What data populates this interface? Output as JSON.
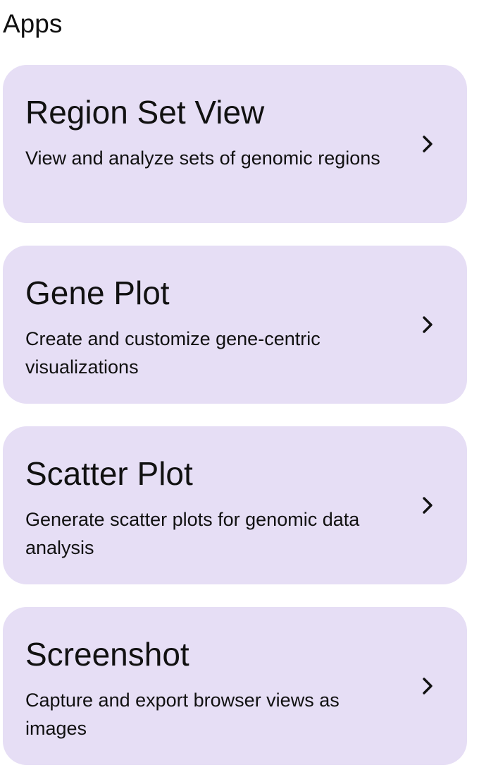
{
  "header": {
    "title": "Apps"
  },
  "apps": [
    {
      "title": "Region Set View",
      "description": "View and analyze sets of genomic regions",
      "icon": "chevron-right-icon"
    },
    {
      "title": "Gene Plot",
      "description": "Create and customize gene-centric visualizations",
      "icon": "chevron-right-icon"
    },
    {
      "title": "Scatter Plot",
      "description": "Generate scatter plots for genomic data analysis",
      "icon": "chevron-right-icon"
    },
    {
      "title": "Screenshot",
      "description": "Capture and export browser views as images",
      "icon": "chevron-right-icon"
    }
  ],
  "colors": {
    "card_background": "#e6def5",
    "text": "#111111"
  }
}
